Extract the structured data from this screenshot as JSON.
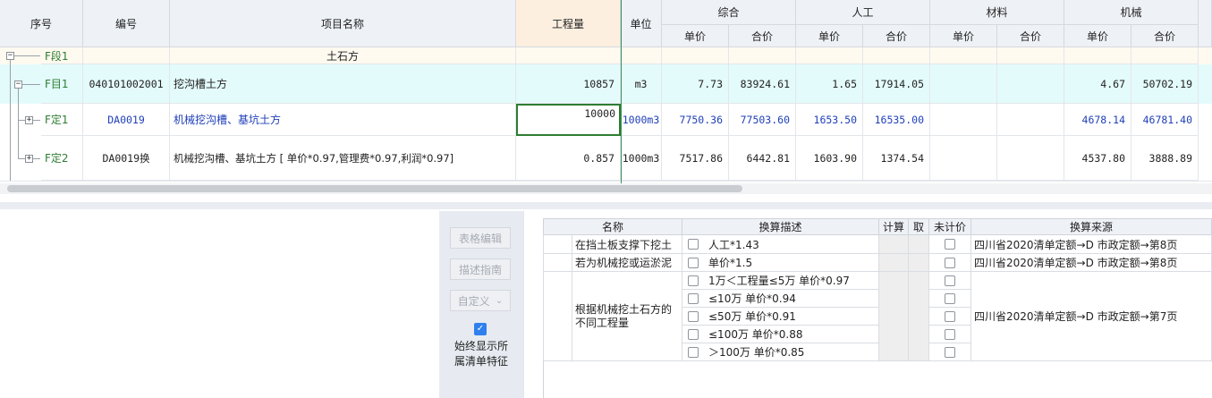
{
  "top_table": {
    "headers": {
      "seq": "序号",
      "code": "编号",
      "name": "项目名称",
      "quantity": "工程量",
      "unit": "单位",
      "group_comprehensive": "综合",
      "group_labor": "人工",
      "group_material": "材料",
      "group_machine": "机械",
      "unit_price": "单价",
      "total_price": "合价"
    },
    "rows": [
      {
        "seq": "F段1",
        "code": "",
        "name": "土石方",
        "quantity": "",
        "unit": "",
        "c_up": "",
        "c_tp": "",
        "l_up": "",
        "l_tp": "",
        "m_up": "",
        "m_tp": "",
        "j_up": "",
        "j_tp": ""
      },
      {
        "seq": "F目1",
        "code": "040101002001",
        "name": "挖沟槽土方",
        "quantity": "10857",
        "unit": "m3",
        "c_up": "7.73",
        "c_tp": "83924.61",
        "l_up": "1.65",
        "l_tp": "17914.05",
        "m_up": "",
        "m_tp": "",
        "j_up": "4.67",
        "j_tp": "50702.19"
      },
      {
        "seq": "F定1",
        "code": "DA0019",
        "name": "机械挖沟槽、基坑土方",
        "quantity": "10000",
        "unit": "1000m3",
        "c_up": "7750.36",
        "c_tp": "77503.60",
        "l_up": "1653.50",
        "l_tp": "16535.00",
        "m_up": "",
        "m_tp": "",
        "j_up": "4678.14",
        "j_tp": "46781.40"
      },
      {
        "seq": "F定2",
        "code": "DA0019换",
        "name": "机械挖沟槽、基坑土方 [ 单价*0.97,管理费*0.97,利润*0.97]",
        "quantity": "0.857",
        "unit": "1000m3",
        "c_up": "7517.86",
        "c_tp": "6442.81",
        "l_up": "1603.90",
        "l_tp": "1374.54",
        "m_up": "",
        "m_tp": "",
        "j_up": "4537.80",
        "j_tp": "3888.89"
      }
    ]
  },
  "side_buttons": {
    "table_edit": "表格编辑",
    "desc_guide": "描述指南",
    "custom": "自定义",
    "custom_arrow": "⌄",
    "always_show": "始终显示所",
    "always_show_2": "属清单特征",
    "check_mark": "✓"
  },
  "conversion_table": {
    "headers": {
      "name": "名称",
      "desc": "换算描述",
      "calc": "计算",
      "take": "取",
      "unpriced": "未计价",
      "source": "换算来源"
    },
    "rows": [
      {
        "name": "在挡土板支撑下挖土",
        "desc": "人工*1.43",
        "source": "四川省2020清单定额→D 市政定额→第8页"
      },
      {
        "name": "若为机械挖或运淤泥",
        "desc": "单价*1.5",
        "source": "四川省2020清单定额→D 市政定额→第8页"
      }
    ],
    "group_row": {
      "name_line1": "根据机械挖土石方的",
      "name_line2": "不同工程量",
      "source": "四川省2020清单定额→D 市政定额→第7页",
      "options": [
        "1万＜工程量≤5万 单价*0.97",
        "≤10万 单价*0.94",
        "≤50万 单价*0.91",
        "≤100万 单价*0.88",
        "＞100万 单价*0.85"
      ]
    }
  },
  "colors": {
    "row_section": "#fffaf0",
    "row_item": "#e4fbfb",
    "accent_blue": "#1f3fb8",
    "accent_green": "#2e7d32",
    "selected_border": "#2e7d32"
  }
}
